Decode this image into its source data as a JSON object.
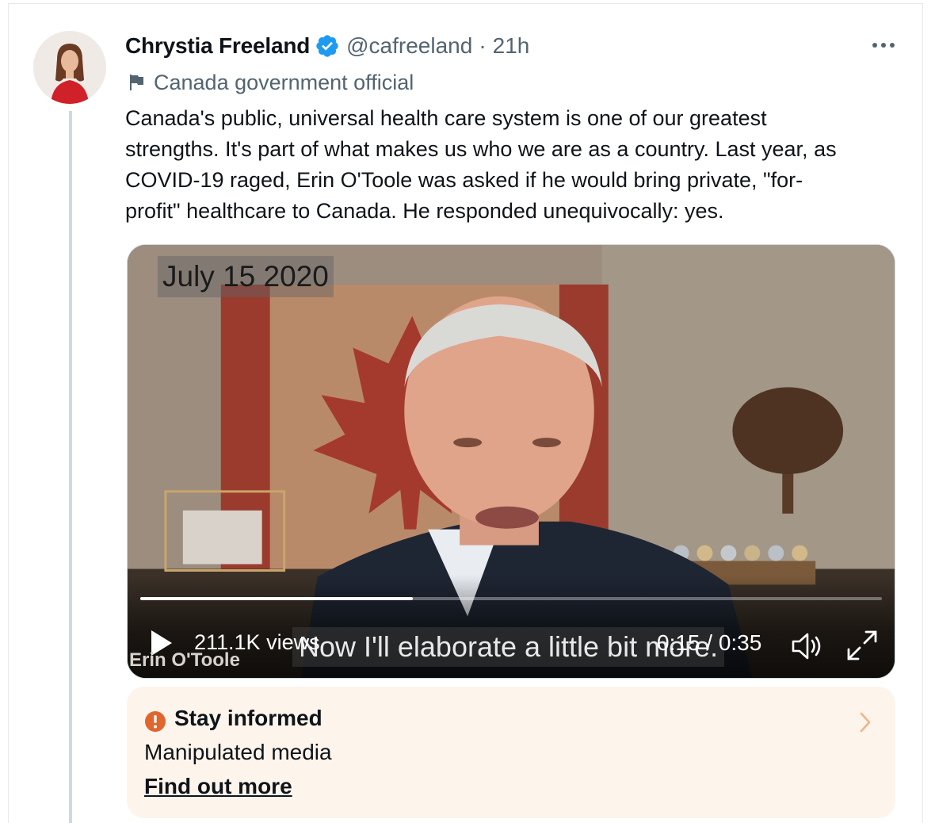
{
  "tweet": {
    "author": {
      "display_name": "Chrystia Freeland",
      "handle": "@cafreeland",
      "separator": "·",
      "time": "21h",
      "verified": true
    },
    "label": {
      "icon": "flag-icon",
      "text": "Canada government official"
    },
    "text_lines": [
      "Canada's public, universal health care system is one of our greatest",
      "strengths. It's part of what makes us who we are as a country. Last year, as",
      "COVID-19 raged, Erin O'Toole was asked if he would bring private, \"for-",
      "profit\" healthcare to Canada. He responded unequivocally: yes."
    ],
    "more_icon": "more-options-icon"
  },
  "media": {
    "date_overlay": "July 15 2020",
    "views": "211.1K views",
    "caption": "Now I'll elaborate a little bit more.",
    "lower_third": "Erin O'Toole",
    "current_time": "0:15",
    "duration": "0:35",
    "timecode": "0:15 / 0:35",
    "progress_fraction": 0.367,
    "icons": [
      "play-icon",
      "volume-icon",
      "fullscreen-icon"
    ]
  },
  "notice": {
    "title": "Stay informed",
    "subtitle": "Manipulated media",
    "link": "Find out more",
    "icon": "alert-icon",
    "accent_color": "#e0662e",
    "background_color": "#fdf4ec"
  },
  "colors": {
    "verified_blue": "#1d9bf0",
    "secondary_text": "#536471",
    "primary_text": "#0f1419"
  }
}
